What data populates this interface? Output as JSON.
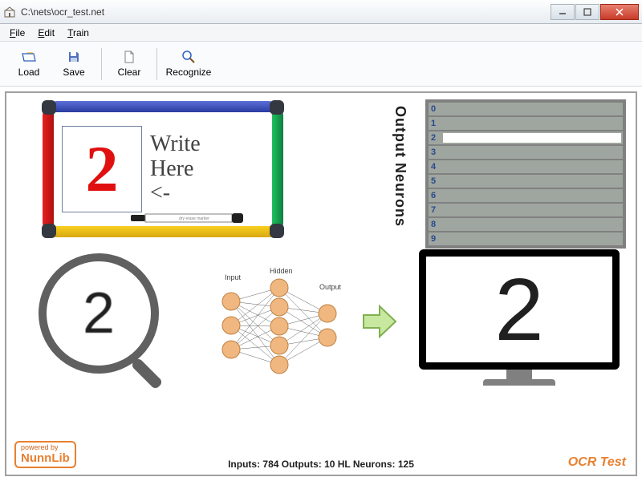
{
  "window": {
    "title": "C:\\nets\\ocr_test.net"
  },
  "menu": {
    "file": "File",
    "edit": "Edit",
    "train": "Train"
  },
  "toolbar": {
    "load": "Load",
    "save": "Save",
    "clear": "Clear",
    "recognize": "Recognize"
  },
  "whiteboard": {
    "drawn_digit": "2",
    "hint_line1": "Write",
    "hint_line2": "Here",
    "hint_line3": "<-"
  },
  "output": {
    "label": "Output Neurons",
    "rows": [
      {
        "idx": "0",
        "value": 0
      },
      {
        "idx": "1",
        "value": 0
      },
      {
        "idx": "2",
        "value": 100
      },
      {
        "idx": "3",
        "value": 0
      },
      {
        "idx": "4",
        "value": 0
      },
      {
        "idx": "5",
        "value": 0
      },
      {
        "idx": "6",
        "value": 0
      },
      {
        "idx": "7",
        "value": 0
      },
      {
        "idx": "8",
        "value": 0
      },
      {
        "idx": "9",
        "value": 0
      }
    ]
  },
  "magnifier": {
    "digit": "2"
  },
  "nn": {
    "input_label": "Input",
    "hidden_label": "Hidden",
    "output_label": "Output"
  },
  "monitor": {
    "digit": "2"
  },
  "badge": {
    "powered": "powered by",
    "name": "NunnLib"
  },
  "stats": {
    "text": "Inputs: 784   Outputs: 10   HL Neurons: 125"
  },
  "corner_label": "OCR Test",
  "colors": {
    "accent_orange": "#e88030",
    "neuron": "#f0b880"
  }
}
